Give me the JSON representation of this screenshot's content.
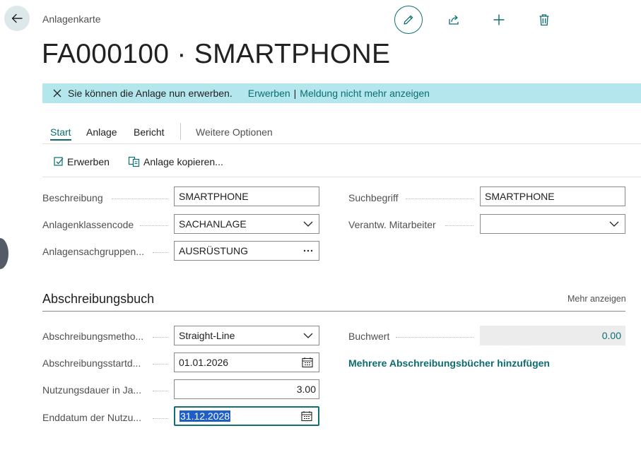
{
  "header": {
    "caption": "Anlagenkarte",
    "title": "FA000100 · SMARTPHONE"
  },
  "banner": {
    "message": "Sie können die Anlage nun erwerben.",
    "action_acquire": "Erwerben",
    "separator": "|",
    "action_dismiss": "Meldung nicht mehr anzeigen"
  },
  "tabs": [
    {
      "label": "Start"
    },
    {
      "label": "Anlage"
    },
    {
      "label": "Bericht"
    },
    {
      "label": "Weitere Optionen"
    }
  ],
  "toolbar": {
    "acquire_label": "Erwerben",
    "copy_label": "Anlage kopieren..."
  },
  "general": {
    "description_label": "Beschreibung",
    "description_value": "SMARTPHONE",
    "class_label": "Anlagenklassencode",
    "class_value": "SACHANLAGE",
    "subclass_label": "Anlagensachgruppen...",
    "subclass_value": "AUSRÜSTUNG",
    "search_label": "Suchbegriff",
    "search_value": "SMARTPHONE",
    "employee_label": "Verantw. Mitarbeiter",
    "employee_value": ""
  },
  "depreciation": {
    "section_title": "Abschreibungsbuch",
    "show_more": "Mehr anzeigen",
    "method_label": "Abschreibungsmetho...",
    "method_value": "Straight-Line",
    "start_label": "Abschreibungsstartd...",
    "start_value": "01.01.2026",
    "years_label": "Nutzungsdauer in Ja...",
    "years_value": "3.00",
    "end_label": "Enddatum der Nutzu...",
    "end_value": "31.12.2028",
    "book_value_label": "Buchwert",
    "book_value": "0.00",
    "add_books_link": "Mehrere Abschreibungsbücher hinzufügen"
  },
  "colors": {
    "accent": "#0c6d70",
    "banner_bg": "#b3e7ed"
  }
}
